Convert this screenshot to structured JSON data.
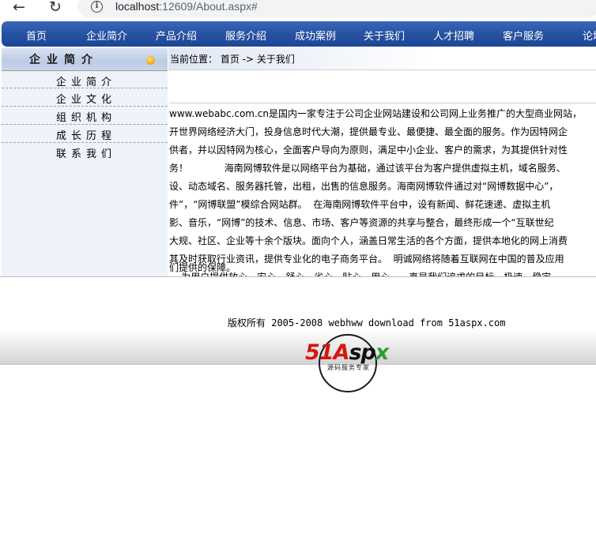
{
  "browser": {
    "url_host": "localhost",
    "url_rest": ":12609/About.aspx#"
  },
  "topnav": {
    "items": [
      "首页",
      "企业简介",
      "产品介绍",
      "服务介绍",
      "成功案例",
      "关于我们",
      "人才招聘",
      "客户服务",
      "论坛"
    ]
  },
  "sidebar": {
    "title": "企业简介",
    "items": [
      "企业简介",
      "企业文化",
      "组织机构",
      "成长历程",
      "联系我们"
    ]
  },
  "breadcrumb": {
    "text": "当前位置： 首页 -> 关于我们"
  },
  "article": {
    "lines": [
      "www.webabc.com.cn是国内一家专注于公司企业网站建设和公司网上业务推广的大型商业网站，",
      "开世界网络经济大门，投身信息时代大潮，提供最专业、最便捷、最全面的服务。作为因特网企",
      "供者，并以因特网为核心，全面客户导向为原则，满足中小企业、客户的需求，为其提供针对性",
      "务！            海南网博软件是以网络平台为基础，通过该平台为客户提供虚拟主机，域名服务、",
      "设、动态域名、服务器托管，出租，出售的信息服务。海南网博软件通过对“网博数据中心”，",
      "件”，“网博联盟”模综合网站群。  在海南网博软件平台中，设有新闻、鲜花速递、虚拟主机",
      "影、音乐，“网博”的技术、信息、市场、客户等资源的共享与整合，最终形成一个“互联世纪",
      "大规、社区、企业等十余个版块。面向个人，涵盖日常生活的各个方面，提供本地化的网上消费",
      "其及时获取行业资讯，提供专业化的电子商务平台。  明诚网络将随着互联网在中国的普及应用",
      "    为用户提供放心、安心、舒心、省心、贴心、用心，一直是我们追求的目标。极速、稳定、",
      "们提供的保障。"
    ]
  },
  "footer": {
    "copyright": "版权所有 2005-2008 webhww download from 51aspx.com",
    "logo_text": "51Aspx",
    "logo_subtitle": "源码服务专家"
  }
}
